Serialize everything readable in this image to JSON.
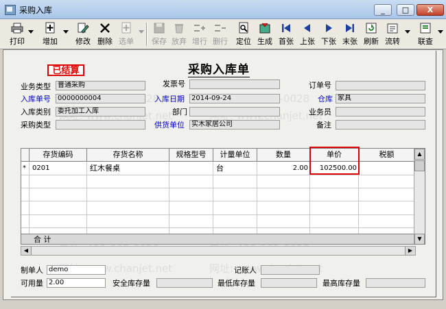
{
  "window": {
    "title": "采购入库",
    "controls": [
      "_",
      "□",
      "X"
    ]
  },
  "toolbar": {
    "buttons": [
      {
        "label": "打印",
        "icon": "printer-icon",
        "enabled": true
      },
      {
        "label": "增加",
        "icon": "add-doc-icon",
        "enabled": true
      },
      {
        "label": "修改",
        "icon": "edit-icon",
        "enabled": true
      },
      {
        "label": "删除",
        "icon": "delete-x-icon",
        "enabled": true
      },
      {
        "label": "选单",
        "icon": "select-doc-icon",
        "enabled": false
      },
      {
        "label": "保存",
        "icon": "save-disk-icon",
        "enabled": false
      },
      {
        "label": "放弃",
        "icon": "discard-icon",
        "enabled": false
      },
      {
        "label": "增行",
        "icon": "add-row-icon",
        "enabled": false
      },
      {
        "label": "删行",
        "icon": "delete-row-icon",
        "enabled": false
      },
      {
        "label": "定位",
        "icon": "locate-icon",
        "enabled": true
      },
      {
        "label": "生成",
        "icon": "generate-icon",
        "enabled": true
      },
      {
        "label": "首张",
        "icon": "first-record-icon",
        "enabled": true
      },
      {
        "label": "上张",
        "icon": "prev-record-icon",
        "enabled": true
      },
      {
        "label": "下张",
        "icon": "next-record-icon",
        "enabled": true
      },
      {
        "label": "末张",
        "icon": "last-record-icon",
        "enabled": true
      },
      {
        "label": "刷新",
        "icon": "refresh-icon",
        "enabled": true
      },
      {
        "label": "流转",
        "icon": "flow-icon",
        "enabled": true
      },
      {
        "label": "联查",
        "icon": "link-query-icon",
        "enabled": true
      }
    ]
  },
  "document": {
    "stamp": "已结算",
    "title": "采购入库单",
    "header_fields": {
      "business_type": {
        "label": "业务类型",
        "value": "普通采购"
      },
      "invoice_no": {
        "label": "发票号",
        "value": ""
      },
      "order_no": {
        "label": "订单号",
        "value": ""
      },
      "receipt_no": {
        "label": "入库单号",
        "value": "0000000004"
      },
      "receipt_date": {
        "label": "入库日期",
        "value": "2014-09-24"
      },
      "warehouse": {
        "label": "仓库",
        "value": "家具"
      },
      "receipt_category": {
        "label": "入库类别",
        "value": "委托加工入库"
      },
      "department": {
        "label": "部门",
        "value": ""
      },
      "salesperson": {
        "label": "业务员",
        "value": ""
      },
      "purchase_type": {
        "label": "采购类型",
        "value": ""
      },
      "supplier": {
        "label": "供货单位",
        "value": "实木家居公司"
      },
      "remarks": {
        "label": "备注",
        "value": ""
      }
    }
  },
  "grid": {
    "columns": [
      "存货编码",
      "存货名称",
      "规格型号",
      "计量单位",
      "数量",
      "单价",
      "税额"
    ],
    "rows": [
      {
        "marker": "*",
        "code": "0201",
        "name": "红木餐桌",
        "spec": "",
        "unit": "台",
        "qty": "2.00",
        "price": "102500.00",
        "tax": ""
      }
    ],
    "total_label": "合 计"
  },
  "footer": {
    "maker": {
      "label": "制单人",
      "value": "demo"
    },
    "bookkeeper": {
      "label": "记账人",
      "value": ""
    },
    "available_qty": {
      "label": "可用量",
      "value": "2.00"
    },
    "safety_stock": {
      "label": "安全库存量",
      "value": ""
    },
    "min_stock": {
      "label": "最低库存量",
      "value": ""
    },
    "max_stock": {
      "label": "最高库存量",
      "value": ""
    }
  },
  "watermarks": {
    "phone": "电话: 400-665-0028",
    "site": "网址: www.chanjet.net"
  }
}
